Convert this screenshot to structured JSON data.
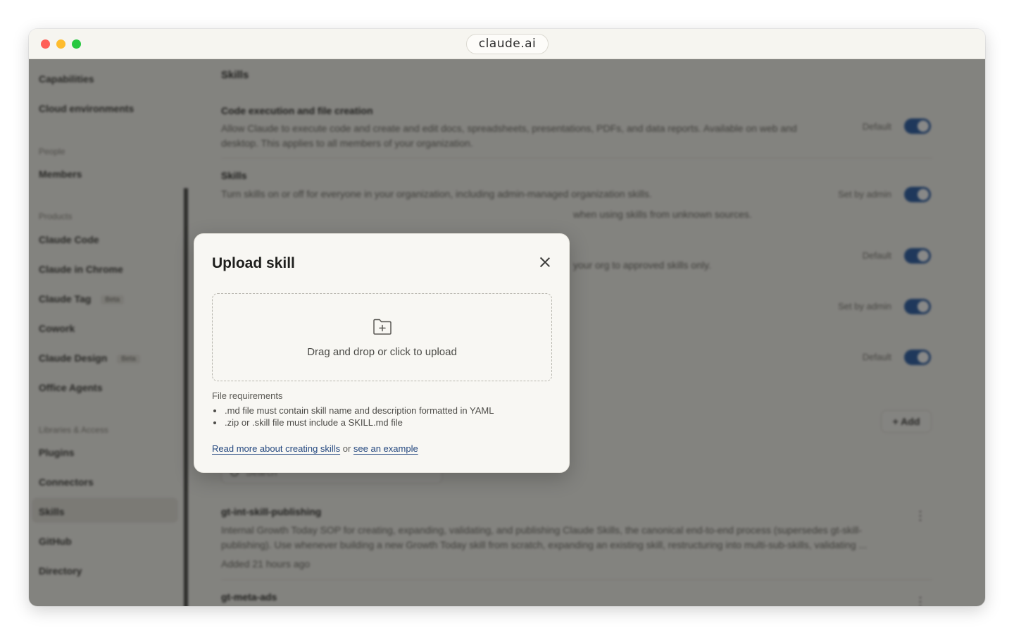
{
  "window": {
    "url": "claude.ai"
  },
  "sidebar": {
    "items": [
      {
        "label": "Capabilities"
      },
      {
        "label": "Cloud environments"
      }
    ],
    "section_people": "People",
    "people_items": [
      {
        "label": "Members"
      }
    ],
    "section_products": "Products",
    "product_items": [
      {
        "label": "Claude Code"
      },
      {
        "label": "Claude in Chrome"
      },
      {
        "label": "Claude Tag",
        "badge": "Beta"
      },
      {
        "label": "Cowork"
      },
      {
        "label": "Claude Design",
        "badge": "Beta"
      },
      {
        "label": "Office Agents"
      }
    ],
    "section_libraries": "Libraries & Access",
    "library_items": [
      {
        "label": "Plugins"
      },
      {
        "label": "Connectors"
      },
      {
        "label": "Skills"
      },
      {
        "label": "GitHub"
      },
      {
        "label": "Directory"
      }
    ]
  },
  "main": {
    "heading": "Skills",
    "settings": [
      {
        "title": "Code execution and file creation",
        "desc": "Allow Claude to execute code and create and edit docs, spreadsheets, presentations, PDFs, and data reports. Available on web and desktop. This applies to all members of your organization.",
        "tag": "Default"
      },
      {
        "title": "Skills",
        "desc": "Turn skills on or off for everyone in your organization, including admin-managed organization skills.",
        "desc2": "when using skills from unknown sources.",
        "tag": "Set by admin"
      },
      {
        "desc": "your org to approved skills only.",
        "tag": "Default"
      },
      {
        "tag": "Set by admin"
      },
      {
        "tag": "Default"
      }
    ],
    "add_label": "+ Add",
    "search_placeholder": "Search",
    "skills": [
      {
        "name": "gt-int-skill-publishing",
        "desc": "Internal Growth Today SOP for creating, expanding, validating, and publishing Claude Skills, the canonical end-to-end process (supersedes gt-skill-publishing). Use whenever building a new Growth Today skill from scratch, expanding an existing skill, restructuring into multi-sub-skills, validating ...",
        "added": "Added 21 hours ago"
      },
      {
        "name": "gt-meta-ads"
      }
    ]
  },
  "modal": {
    "title": "Upload skill",
    "drop_text": "Drag and drop or click to upload",
    "requirements_title": "File requirements",
    "requirements": [
      ".md file must contain skill name and description formatted in YAML",
      ".zip or .skill file must include a SKILL.md file"
    ],
    "link_read_more": "Read more about creating skills",
    "link_or": "or",
    "link_example": "see an example"
  }
}
